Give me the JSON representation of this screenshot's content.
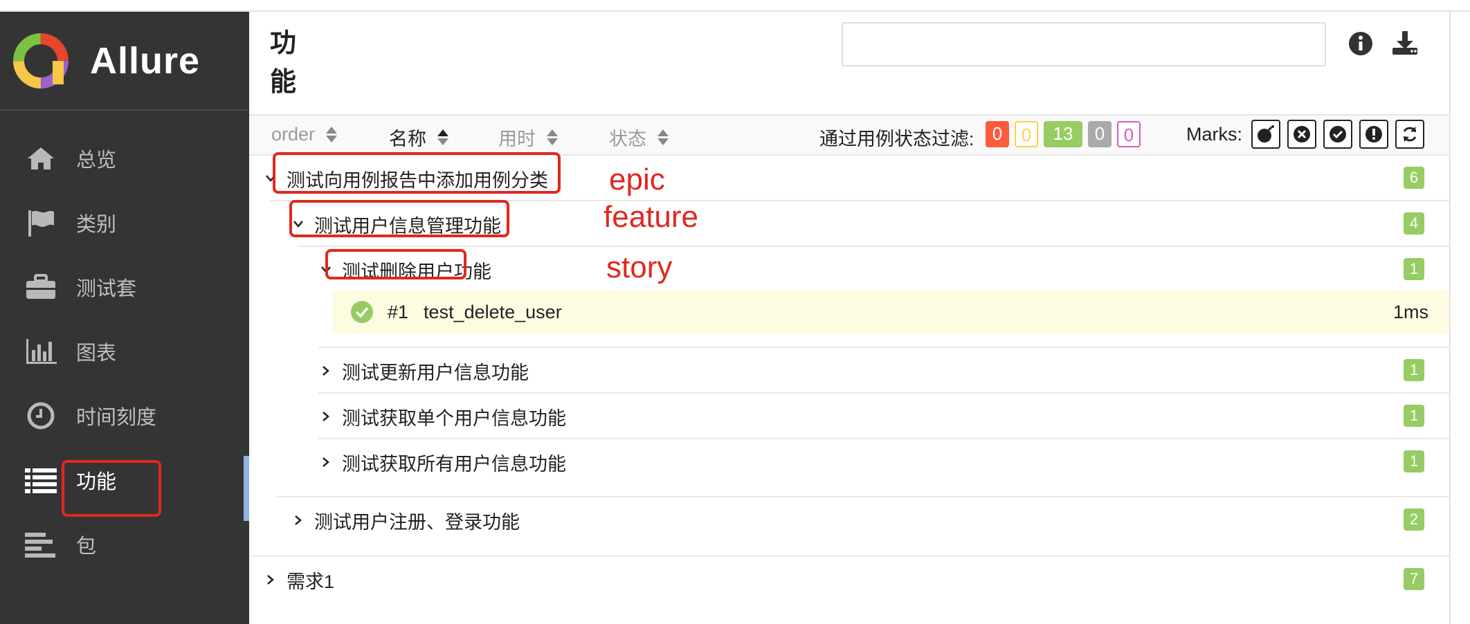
{
  "app": {
    "name": "Allure"
  },
  "sidebar": {
    "items": [
      {
        "label": "总览",
        "icon": "home-icon"
      },
      {
        "label": "类别",
        "icon": "flag-icon"
      },
      {
        "label": "测试套",
        "icon": "briefcase-icon"
      },
      {
        "label": "图表",
        "icon": "bar-chart-icon"
      },
      {
        "label": "时间刻度",
        "icon": "clock-icon"
      },
      {
        "label": "功能",
        "icon": "list-icon",
        "active": true
      },
      {
        "label": "包",
        "icon": "align-left-icon"
      }
    ]
  },
  "page": {
    "title": "功能"
  },
  "search": {
    "placeholder": "",
    "value": ""
  },
  "table_header": {
    "columns": [
      "order",
      "名称",
      "用时",
      "状态"
    ],
    "filter_label": "通过用例状态过滤:",
    "status_counts": [
      {
        "value": "0",
        "color": "#fd5a3e",
        "status": "failed"
      },
      {
        "value": "0",
        "color": "#ffd050",
        "status": "broken"
      },
      {
        "value": "13",
        "color": "#97cc64",
        "status": "passed"
      },
      {
        "value": "0",
        "color": "#aaaaaa",
        "status": "skipped"
      },
      {
        "value": "0",
        "color": "#d35ebe",
        "status": "unknown"
      }
    ],
    "marks_label": "Marks:",
    "marks": [
      "bomb-icon",
      "times-circle-icon",
      "check-circle-icon",
      "exclamation-circle-icon",
      "refresh-icon"
    ]
  },
  "tree": {
    "epic": {
      "label": "测试向用例报告中添加用例分类",
      "count": "6"
    },
    "feature": {
      "label": "测试用户信息管理功能",
      "count": "4"
    },
    "story": {
      "label": "测试删除用户功能",
      "count": "1"
    },
    "test_case": {
      "order": "#1",
      "name": "test_delete_user",
      "duration": "1ms",
      "status": "passed"
    },
    "stories_collapsed": [
      {
        "label": "测试更新用户信息功能",
        "count": "1"
      },
      {
        "label": "测试获取单个用户信息功能",
        "count": "1"
      },
      {
        "label": "测试获取所有用户信息功能",
        "count": "1"
      }
    ],
    "feature2": {
      "label": "测试用户注册、登录功能",
      "count": "2"
    },
    "epic2": {
      "label": "需求1",
      "count": "7"
    }
  },
  "annotations": {
    "epic": "epic",
    "feature": "feature",
    "story": "story"
  },
  "colors": {
    "sidebar_bg": "#343434",
    "annotation": "#e0281e",
    "passed": "#97cc64",
    "case_highlight": "#fdfce1"
  }
}
